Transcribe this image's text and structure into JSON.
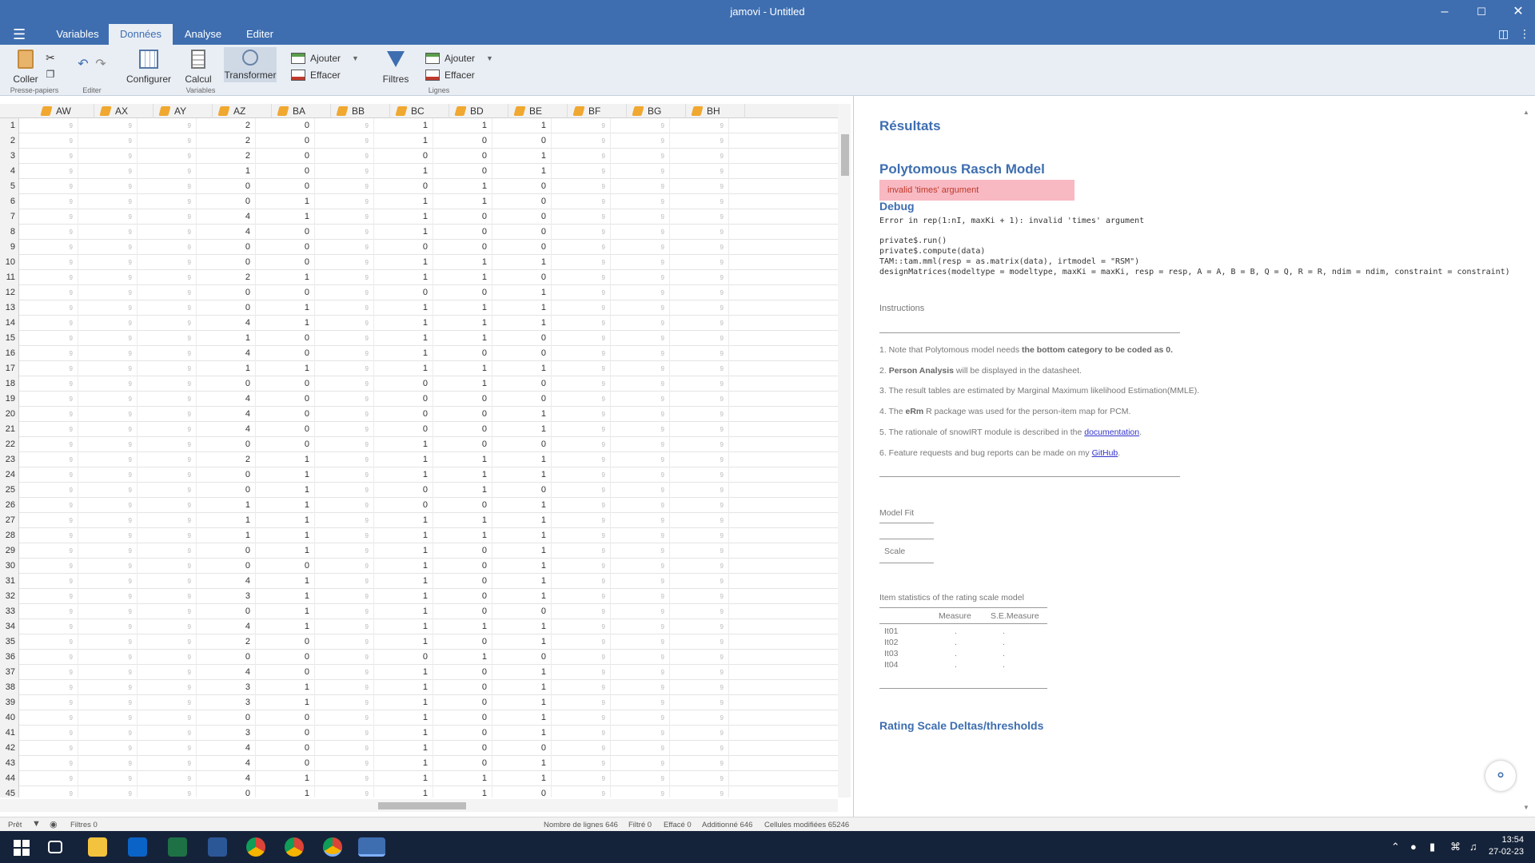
{
  "window": {
    "title": "jamovi - Untitled"
  },
  "tabs": [
    "Variables",
    "Données",
    "Analyse",
    "Editer"
  ],
  "ribbon": {
    "coller": "Coller",
    "group_clipboard": "Presse-papiers",
    "group_edit": "Editer",
    "configurer": "Configurer",
    "calcul": "Calcul",
    "transformer": "Transformer",
    "group_variables": "Variables",
    "ajouter_col": "Ajouter",
    "effacer_col": "Effacer",
    "filtres": "Filtres",
    "ajouter_row": "Ajouter",
    "effacer_row": "Effacer",
    "group_lignes": "Lignes"
  },
  "columns": [
    "AW",
    "AX",
    "AY",
    "AZ",
    "BA",
    "BB",
    "BC",
    "BD",
    "BE",
    "BF",
    "BG",
    "BH"
  ],
  "missing_glyph": "9",
  "data_rows": [
    [
      2,
      0,
      1,
      1,
      1
    ],
    [
      2,
      0,
      1,
      0,
      0
    ],
    [
      2,
      0,
      0,
      0,
      1
    ],
    [
      1,
      0,
      1,
      0,
      1
    ],
    [
      0,
      0,
      0,
      1,
      0
    ],
    [
      0,
      1,
      1,
      1,
      0
    ],
    [
      4,
      1,
      1,
      0,
      0
    ],
    [
      4,
      0,
      1,
      0,
      0
    ],
    [
      0,
      0,
      0,
      0,
      0
    ],
    [
      0,
      0,
      1,
      1,
      1
    ],
    [
      2,
      1,
      1,
      1,
      0
    ],
    [
      0,
      0,
      0,
      0,
      1
    ],
    [
      0,
      1,
      1,
      1,
      1
    ],
    [
      4,
      1,
      1,
      1,
      1
    ],
    [
      1,
      0,
      1,
      1,
      0
    ],
    [
      4,
      0,
      1,
      0,
      0
    ],
    [
      1,
      1,
      1,
      1,
      1
    ],
    [
      0,
      0,
      0,
      1,
      0
    ],
    [
      4,
      0,
      0,
      0,
      0
    ],
    [
      4,
      0,
      0,
      0,
      1
    ],
    [
      4,
      0,
      0,
      0,
      1
    ],
    [
      0,
      0,
      1,
      0,
      0
    ],
    [
      2,
      1,
      1,
      1,
      1
    ],
    [
      0,
      1,
      1,
      1,
      1
    ],
    [
      0,
      1,
      0,
      1,
      0
    ],
    [
      1,
      1,
      0,
      0,
      1
    ],
    [
      1,
      1,
      1,
      1,
      1
    ],
    [
      1,
      1,
      1,
      1,
      1
    ],
    [
      0,
      1,
      1,
      0,
      1
    ],
    [
      0,
      0,
      1,
      0,
      1
    ],
    [
      4,
      1,
      1,
      0,
      1
    ],
    [
      3,
      1,
      1,
      0,
      1
    ],
    [
      0,
      1,
      1,
      0,
      0
    ],
    [
      4,
      1,
      1,
      1,
      1
    ],
    [
      2,
      0,
      1,
      0,
      1
    ],
    [
      0,
      0,
      0,
      1,
      0
    ],
    [
      4,
      0,
      1,
      0,
      1
    ],
    [
      3,
      1,
      1,
      0,
      1
    ],
    [
      3,
      1,
      1,
      0,
      1
    ],
    [
      0,
      0,
      1,
      0,
      1
    ],
    [
      3,
      0,
      1,
      0,
      1
    ],
    [
      4,
      0,
      1,
      0,
      0
    ],
    [
      4,
      0,
      1,
      0,
      1
    ],
    [
      4,
      1,
      1,
      1,
      1
    ],
    [
      0,
      1,
      1,
      1,
      0
    ]
  ],
  "results": {
    "heading": "Résultats",
    "analysis_title": "Polytomous Rasch Model",
    "error_banner": "invalid 'times' argument",
    "debug_title": "Debug",
    "debug_error": "Error in rep(1:nI, maxKi + 1): invalid 'times' argument",
    "traceback": [
      "private$.run()",
      "private$.compute(data)",
      "TAM::tam.mml(resp = as.matrix(data), irtmodel = \"RSM\")",
      "designMatrices(modeltype = modeltype, maxKi = maxKi, resp = resp, A = A, B = B, Q = Q, R = R, ndim = ndim, constraint = constraint)"
    ],
    "instructions_label": "Instructions",
    "instr1_a": "1. Note that Polytomous model needs ",
    "instr1_b": "the bottom category to be coded as 0.",
    "instr2_a": "2. ",
    "instr2_b": "Person Analysis",
    "instr2_c": " will be displayed in the datasheet.",
    "instr3": "3. The result tables are estimated by Marginal Maximum likelihood Estimation(MMLE).",
    "instr4_a": "4. The ",
    "instr4_b": "eRm",
    "instr4_c": " R package was used for the person-item map for PCM.",
    "instr5_a": "5. The rationale of snowIRT module is described in the ",
    "instr5_link": "documentation",
    "instr5_b": ".",
    "instr6_a": "6. Feature requests and bug reports can be made on my ",
    "instr6_link": "GitHub",
    "instr6_b": ".",
    "model_fit": "Model Fit",
    "scale": "Scale",
    "item_table_title": "Item statistics of the rating scale model",
    "col_measure": "Measure",
    "col_se": "S.E.Measure",
    "items": [
      {
        "name": "It01",
        "measure": ".",
        "se": "."
      },
      {
        "name": "It02",
        "measure": ".",
        "se": "."
      },
      {
        "name": "It03",
        "measure": ".",
        "se": "."
      },
      {
        "name": "It04",
        "measure": ".",
        "se": "."
      }
    ],
    "rating_title": "Rating Scale Deltas/thresholds"
  },
  "status": {
    "ready": "Prêt",
    "filters": "Filtres 0",
    "rows": "Nombre de lignes 646",
    "filtered": "Filtré 0",
    "deleted": "Effacé 0",
    "added": "Additionné 646",
    "modified": "Cellules modifiées 65246"
  },
  "clock": {
    "time": "13:54",
    "date": "27-02-23"
  }
}
